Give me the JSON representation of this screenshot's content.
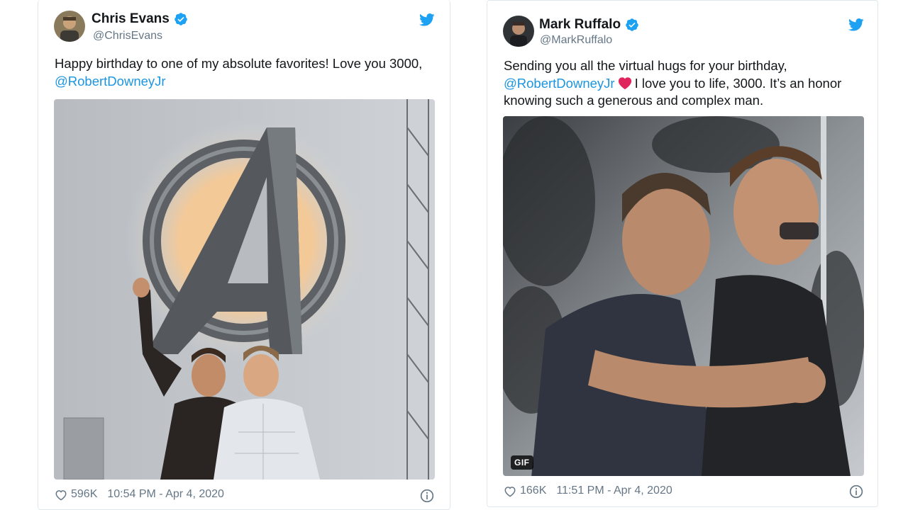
{
  "tweets": [
    {
      "name": "Chris Evans",
      "handle": "@ChrisEvans",
      "text_line1": "Happy birthday to one of my absolute favorites! Love you 3000,",
      "mention": "@RobertDowneyJr",
      "likes": "596K",
      "timestamp": "10:54 PM - Apr 4, 2020",
      "verified": true,
      "media": "photo"
    },
    {
      "name": "Mark Ruffalo",
      "handle": "@MarkRuffalo",
      "text_line1": "Sending you all the virtual hugs for your birthday,",
      "mention": "@RobertDowneyJr",
      "text_after_mention": "I love you to life, 3000. It’s an honor",
      "text_line3": "knowing such a generous and complex man.",
      "likes": "166K",
      "timestamp": "11:51 PM - Apr 4, 2020",
      "verified": true,
      "media": "gif",
      "media_badge": "GIF"
    }
  ],
  "colors": {
    "twitter_blue": "#1da1f2",
    "mention_blue": "#1b95e0",
    "secondary_text": "#657786",
    "heart_red": "#e0245e"
  },
  "icons": [
    "verified-badge-icon",
    "twitter-bird-icon",
    "like-heart-icon",
    "info-icon",
    "red-heart-emoji"
  ]
}
